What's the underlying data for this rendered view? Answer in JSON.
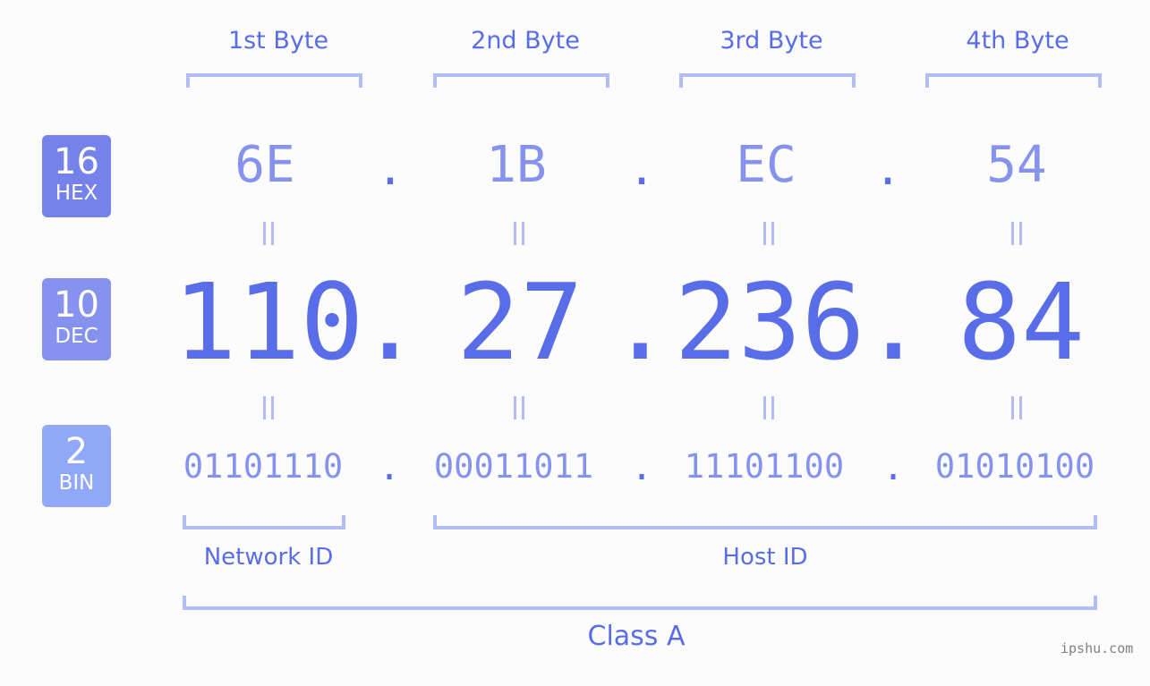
{
  "bytes": {
    "labels": [
      "1st Byte",
      "2nd Byte",
      "3rd Byte",
      "4th Byte"
    ]
  },
  "bases": {
    "hex": {
      "num": "16",
      "label": "HEX",
      "color": "#7482ea"
    },
    "dec": {
      "num": "10",
      "label": "DEC",
      "color": "#8593ef"
    },
    "bin": {
      "num": "2",
      "label": "BIN",
      "color": "#90a8f7"
    }
  },
  "values": {
    "hex": [
      "6E",
      "1B",
      "EC",
      "54"
    ],
    "dec": [
      "110",
      "27",
      "236",
      "84"
    ],
    "bin": [
      "01101110",
      "00011011",
      "11101100",
      "01010100"
    ]
  },
  "separator": ".",
  "segments": {
    "network": "Network ID",
    "host": "Host ID",
    "class": "Class A"
  },
  "watermark": "ipshu.com",
  "colors": {
    "accent": "#5a6de8",
    "light": "#8592ee",
    "bracket": "#b3bdf5",
    "background": "#fbfcfb"
  }
}
